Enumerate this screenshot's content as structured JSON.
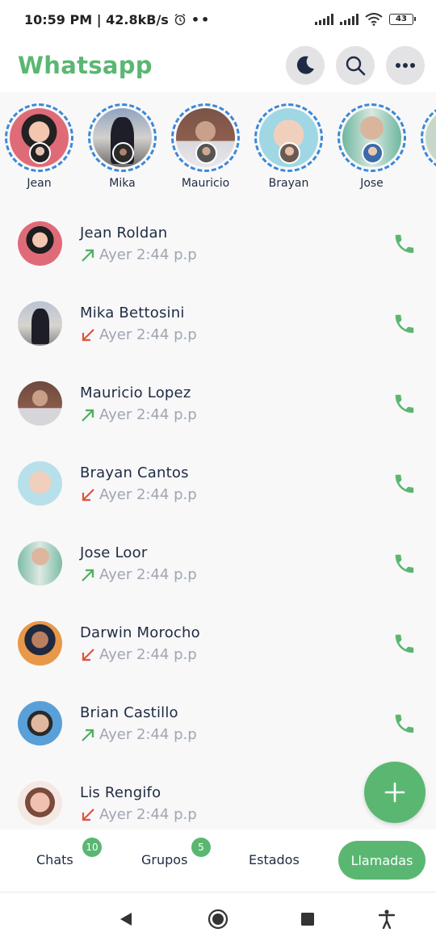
{
  "status_bar": {
    "time_speed": "10:59 PM | 42.8kB/s",
    "dots": "••",
    "battery": "43"
  },
  "header": {
    "title": "Whatsapp",
    "actions": [
      "moon-icon",
      "search-icon",
      "more-icon"
    ]
  },
  "stories": [
    {
      "name": "Jean"
    },
    {
      "name": "Mika"
    },
    {
      "name": "Mauricio"
    },
    {
      "name": "Brayan"
    },
    {
      "name": "Jose"
    },
    {
      "name": ""
    }
  ],
  "calls": [
    {
      "name": "Jean Roldan",
      "time": "Ayer 2:44 p.p",
      "direction": "outgoing"
    },
    {
      "name": "Mika Bettosini",
      "time": "Ayer 2:44 p.p",
      "direction": "incoming"
    },
    {
      "name": "Mauricio Lopez",
      "time": "Ayer 2:44 p.p",
      "direction": "outgoing"
    },
    {
      "name": "Brayan Cantos",
      "time": "Ayer 2:44 p.p",
      "direction": "incoming"
    },
    {
      "name": "Jose Loor",
      "time": "Ayer 2:44 p.p",
      "direction": "outgoing"
    },
    {
      "name": "Darwin Morocho",
      "time": "Ayer 2:44 p.p",
      "direction": "incoming"
    },
    {
      "name": "Brian Castillo",
      "time": "Ayer 2:44 p.p",
      "direction": "outgoing"
    },
    {
      "name": "Lis Rengifo",
      "time": "Ayer 2:44 p.p",
      "direction": "incoming"
    }
  ],
  "tabs": {
    "chats": {
      "label": "Chats",
      "badge": "10"
    },
    "grupos": {
      "label": "Grupos",
      "badge": "5"
    },
    "estados": {
      "label": "Estados"
    },
    "llamadas": {
      "label": "Llamadas"
    }
  },
  "colors": {
    "accent": "#5ab772",
    "story_ring": "#3b88d9",
    "outgoing_arrow": "#4caf62",
    "incoming_arrow": "#e0523f"
  }
}
